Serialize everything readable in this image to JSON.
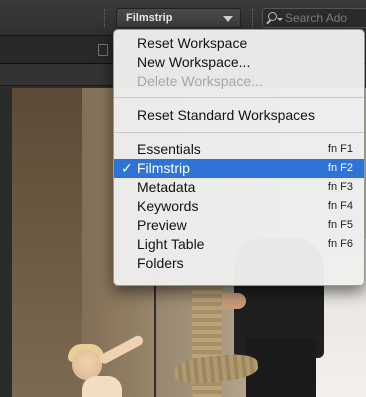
{
  "toolbar": {
    "workspace_label": "Filmstrip",
    "search_placeholder": "Search Ado"
  },
  "menu": {
    "group1": [
      {
        "label": "Reset Workspace",
        "enabled": true
      },
      {
        "label": "New Workspace...",
        "enabled": true
      },
      {
        "label": "Delete Workspace...",
        "enabled": false
      }
    ],
    "group2": [
      {
        "label": "Reset Standard Workspaces",
        "enabled": true
      }
    ],
    "group3": [
      {
        "label": "Essentials",
        "shortcut": "fn F1",
        "checked": false
      },
      {
        "label": "Filmstrip",
        "shortcut": "fn F2",
        "checked": true
      },
      {
        "label": "Metadata",
        "shortcut": "fn F3",
        "checked": false
      },
      {
        "label": "Keywords",
        "shortcut": "fn F4",
        "checked": false
      },
      {
        "label": "Preview",
        "shortcut": "fn F5",
        "checked": false
      },
      {
        "label": "Light Table",
        "shortcut": "fn F6",
        "checked": false
      },
      {
        "label": "Folders",
        "shortcut": "",
        "checked": false
      }
    ],
    "check_glyph": "✓"
  },
  "colors": {
    "highlight": "#2e74d6",
    "menu_bg": "#eeeeee",
    "app_bg": "#2b2b2b"
  }
}
